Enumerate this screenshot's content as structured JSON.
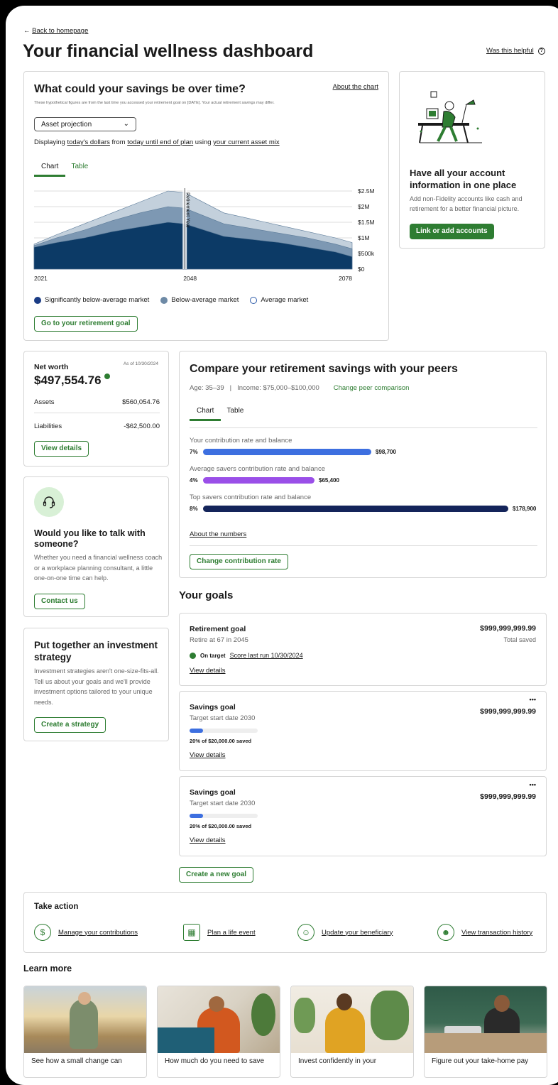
{
  "header": {
    "back_link": "Back to homepage",
    "page_title": "Your financial wellness dashboard",
    "helpful_link": "Was this helpful"
  },
  "savings_chart_card": {
    "title": "What could your savings be over time?",
    "about_link": "About the chart",
    "disclaimer": "These hypothetical figures are from the last time you accessed your retirement goal on [DATE]. Your actual retirement savings may differ.",
    "dropdown_value": "Asset projection",
    "displaying_prefix": "Displaying",
    "dollars_link": "today's dollars",
    "from_text": "from",
    "period_link": "today until end of plan",
    "using_text": "using",
    "mix_link": "your current asset mix",
    "tab_chart": "Chart",
    "tab_table": "Table",
    "marker_label": "Retirement Year",
    "legend": [
      "Significantly below-average market",
      "Below-average market",
      "Average market"
    ],
    "cta": "Go to your retirement goal"
  },
  "chart_data": {
    "type": "area",
    "x": [
      2021,
      2025,
      2030,
      2035,
      2040,
      2045,
      2048,
      2055,
      2060,
      2065,
      2070,
      2075,
      2078
    ],
    "x_tick_labels": [
      "2021",
      "2048",
      "2078"
    ],
    "y_tick_labels": [
      "$2.5M",
      "$2M",
      "$1.5M",
      "$1M",
      "$500k",
      "$0"
    ],
    "ylim": [
      0,
      2500000
    ],
    "marker_x": 2048,
    "series": [
      {
        "name": "Average market",
        "color": "#c3d0dc",
        "values": [
          800000,
          1100000,
          1450000,
          1800000,
          2150000,
          2500000,
          2450000,
          1800000,
          1600000,
          1400000,
          1200000,
          1000000,
          850000
        ]
      },
      {
        "name": "Below-average market",
        "color": "#7d98b3",
        "values": [
          750000,
          1000000,
          1250000,
          1550000,
          1800000,
          2000000,
          1950000,
          1450000,
          1300000,
          1150000,
          1000000,
          800000,
          650000
        ]
      },
      {
        "name": "Significantly below-average market",
        "color": "#0c3a66",
        "values": [
          700000,
          850000,
          1000000,
          1200000,
          1350000,
          1500000,
          1450000,
          1050000,
          950000,
          850000,
          700000,
          550000,
          400000
        ]
      }
    ],
    "grid": true
  },
  "accounts_promo": {
    "title": "Have all your account information in one place",
    "body": "Add non-Fidelity accounts like cash and retirement for a better financial picture.",
    "cta": "Link or add accounts"
  },
  "net_worth": {
    "label": "Net worth",
    "as_of": "As of 10/30/2024",
    "value": "$497,554.76",
    "assets_label": "Assets",
    "assets_value": "$560,054.76",
    "liabilities_label": "Liabilities",
    "liabilities_value": "-$62,500.00",
    "cta": "View details"
  },
  "talk_card": {
    "title": "Would you like to talk with someone?",
    "body": "Whether you need a financial wellness coach or a workplace planning consultant, a little one-on-one time can help.",
    "cta": "Contact us"
  },
  "strategy_card": {
    "title": "Put together an investment strategy",
    "body": "Investment strategies aren't one-size-fits-all. Tell us about your goals and we'll provide investment options tailored to your unique needs.",
    "cta": "Create a strategy"
  },
  "peers_card": {
    "title": "Compare your retirement savings with your peers",
    "age": "Age: 35–39",
    "separator": "|",
    "income": "Income: $75,000–$100,000",
    "change_link": "Change peer comparison",
    "tab_chart": "Chart",
    "tab_table": "Table",
    "rows": [
      {
        "label": "Your contribution rate and balance",
        "rate": "7%",
        "balance": "$98,700",
        "fraction": 0.552,
        "color": "#3d6fe0"
      },
      {
        "label": "Average savers contribution rate and balance",
        "rate": "4%",
        "balance": "$65,400",
        "fraction": 0.366,
        "color": "#9a4fe8"
      },
      {
        "label": "Top savers contribution rate and balance",
        "rate": "8%",
        "balance": "$178,900",
        "fraction": 1.0,
        "color": "#14245a"
      }
    ],
    "about_link": "About the numbers",
    "cta": "Change contribution rate"
  },
  "goals": {
    "heading": "Your goals",
    "retirement": {
      "title": "Retirement goal",
      "subtitle": "Retire at 67 in 2045",
      "amount": "$999,999,999.99",
      "amount_label": "Total saved",
      "status": "On target",
      "score_link": "Score last run 10/30/2024",
      "details_link": "View details"
    },
    "savings": [
      {
        "title": "Savings goal",
        "subtitle": "Target start date 2030",
        "amount": "$999,999,999.99",
        "progress_text": "20% of $20,000.00 saved",
        "progress": 0.2,
        "details_link": "View details",
        "menu": "•••"
      },
      {
        "title": "Savings goal",
        "subtitle": "Target start date 2030",
        "amount": "$999,999,999.99",
        "progress_text": "20% of $20,000.00 saved",
        "progress": 0.2,
        "details_link": "View details",
        "menu": "•••"
      }
    ],
    "new_goal_cta": "Create a new goal"
  },
  "take_action": {
    "heading": "Take action",
    "items": [
      {
        "label": "Manage your contributions",
        "icon": "piggy-bank-icon"
      },
      {
        "label": "Plan a life event",
        "icon": "calendar-icon"
      },
      {
        "label": "Update your beneficiary",
        "icon": "person-icon"
      },
      {
        "label": "View transaction history",
        "icon": "person-laptop-icon"
      }
    ]
  },
  "learn_more": {
    "heading": "Learn more",
    "cards": [
      {
        "caption": "See how a small change can"
      },
      {
        "caption": "How much do you need to save"
      },
      {
        "caption": "Invest confidently in your"
      },
      {
        "caption": "Figure out your take-home pay"
      }
    ]
  }
}
